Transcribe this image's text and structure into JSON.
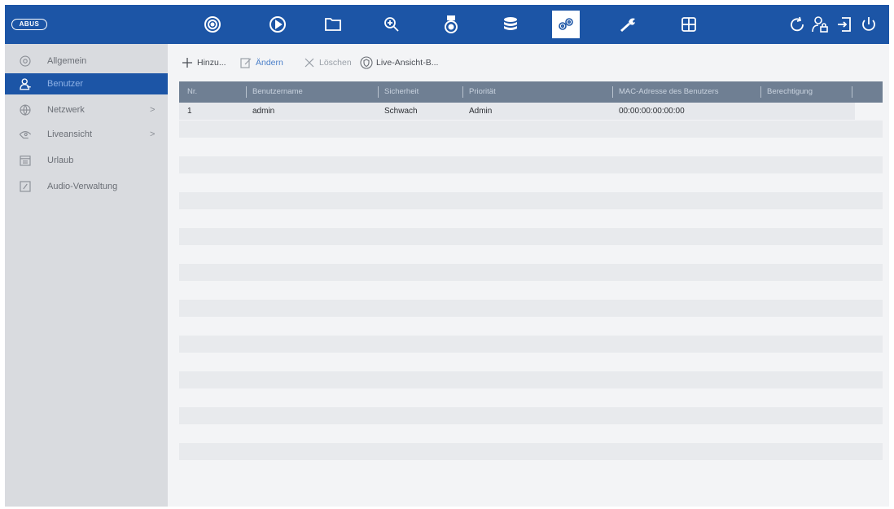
{
  "topbar": {
    "logo": "ABUS",
    "nav_icons": [
      "live-view-icon",
      "playback-icon",
      "file-management-icon",
      "smart-search-icon",
      "camera-icon",
      "storage-icon",
      "configuration-icon",
      "maintenance-icon",
      "multi-view-icon"
    ],
    "active": "configuration-icon",
    "right_icons": [
      "refresh-icon",
      "user-lock-icon",
      "logout-icon",
      "power-icon"
    ]
  },
  "sidebar": {
    "items": [
      {
        "label": "Allgemein",
        "icon": "general-settings-icon",
        "active": false,
        "has_submenu": false
      },
      {
        "label": "Benutzer",
        "icon": "user-icon",
        "active": true,
        "has_submenu": false
      },
      {
        "label": "Netzwerk",
        "icon": "network-globe-icon",
        "active": false,
        "has_submenu": true
      },
      {
        "label": "Liveansicht",
        "icon": "liveview-icon",
        "active": false,
        "has_submenu": true
      },
      {
        "label": "Urlaub",
        "icon": "calendar-icon",
        "active": false,
        "has_submenu": false
      },
      {
        "label": "Audio-Verwaltung",
        "icon": "audio-icon",
        "active": false,
        "has_submenu": false
      }
    ],
    "chevron": ">"
  },
  "toolbar": {
    "add_label": "Hinzu...",
    "edit_label": "Ändern",
    "delete_label": "Löschen",
    "liveview_label": "Live-Ansicht-B..."
  },
  "table": {
    "columns": [
      "Nr.",
      "Benutzername",
      "Sicherheit",
      "Priorität",
      "MAC-Adresse des Benutzers",
      "Berechtigung"
    ],
    "rows": [
      [
        "1",
        "admin",
        "Schwach",
        "Admin",
        "00:00:00:00:00:00",
        ""
      ]
    ]
  },
  "colors": {
    "topbar": "#1c55a6",
    "sidebar": "#d9dbdf",
    "table_header": "#6f7f93",
    "accent": "#4a7fc9"
  }
}
